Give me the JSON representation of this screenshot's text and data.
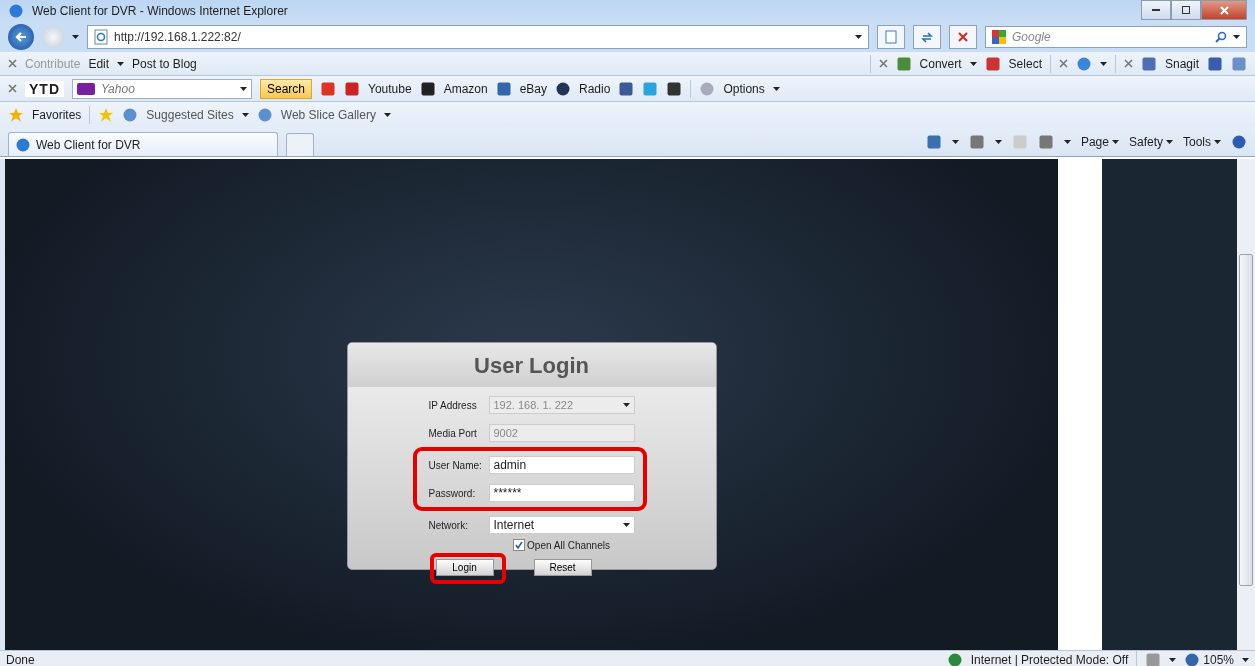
{
  "window": {
    "title": "Web Client for DVR - Windows Internet Explorer"
  },
  "address_bar": {
    "url": "http://192.168.1.222:82/"
  },
  "search_box": {
    "placeholder": "Google"
  },
  "command_bar_1": {
    "left": [
      {
        "label": "Contribute",
        "disabled": true
      },
      {
        "label": "Edit",
        "disabled": false
      },
      {
        "label": "Post to Blog",
        "disabled": false
      }
    ],
    "right": [
      "Convert",
      "Select",
      "Snagit"
    ]
  },
  "toolbar_2": {
    "brand": "YTD",
    "search": {
      "placeholder": "Yahoo"
    },
    "search_button": "Search",
    "links": [
      "Youtube",
      "Amazon",
      "eBay",
      "Radio"
    ],
    "options": "Options"
  },
  "favorites_bar": {
    "favorites": "Favorites",
    "items": [
      "Suggested Sites",
      "Web Slice Gallery"
    ]
  },
  "tabs": [
    {
      "label": "Web Client for DVR",
      "selected": true
    }
  ],
  "command_bar": [
    "Page",
    "Safety",
    "Tools"
  ],
  "login": {
    "title": "User Login",
    "fields": [
      {
        "label": "IP Address",
        "value": "192. 168. 1. 222",
        "kind": "select",
        "disabled": true,
        "highlighted": false
      },
      {
        "label": "Media Port",
        "value": "9002",
        "kind": "text",
        "disabled": true,
        "highlighted": false
      },
      {
        "label": "User Name:",
        "value": "admin",
        "kind": "text",
        "disabled": false,
        "highlighted": true
      },
      {
        "label": "Password:",
        "value": "******",
        "kind": "text",
        "disabled": false,
        "highlighted": true
      },
      {
        "label": "Network:",
        "value": "Internet",
        "kind": "select",
        "disabled": false,
        "highlighted": false
      }
    ],
    "open_all_channels": {
      "label": "Open All Channels",
      "checked": true
    },
    "buttons": [
      {
        "label": "Login",
        "highlighted": true
      },
      {
        "label": "Reset",
        "highlighted": false
      }
    ]
  },
  "status_bar": {
    "text": "Done",
    "zone": "Internet | Protected Mode: Off",
    "zoom": "105%"
  }
}
